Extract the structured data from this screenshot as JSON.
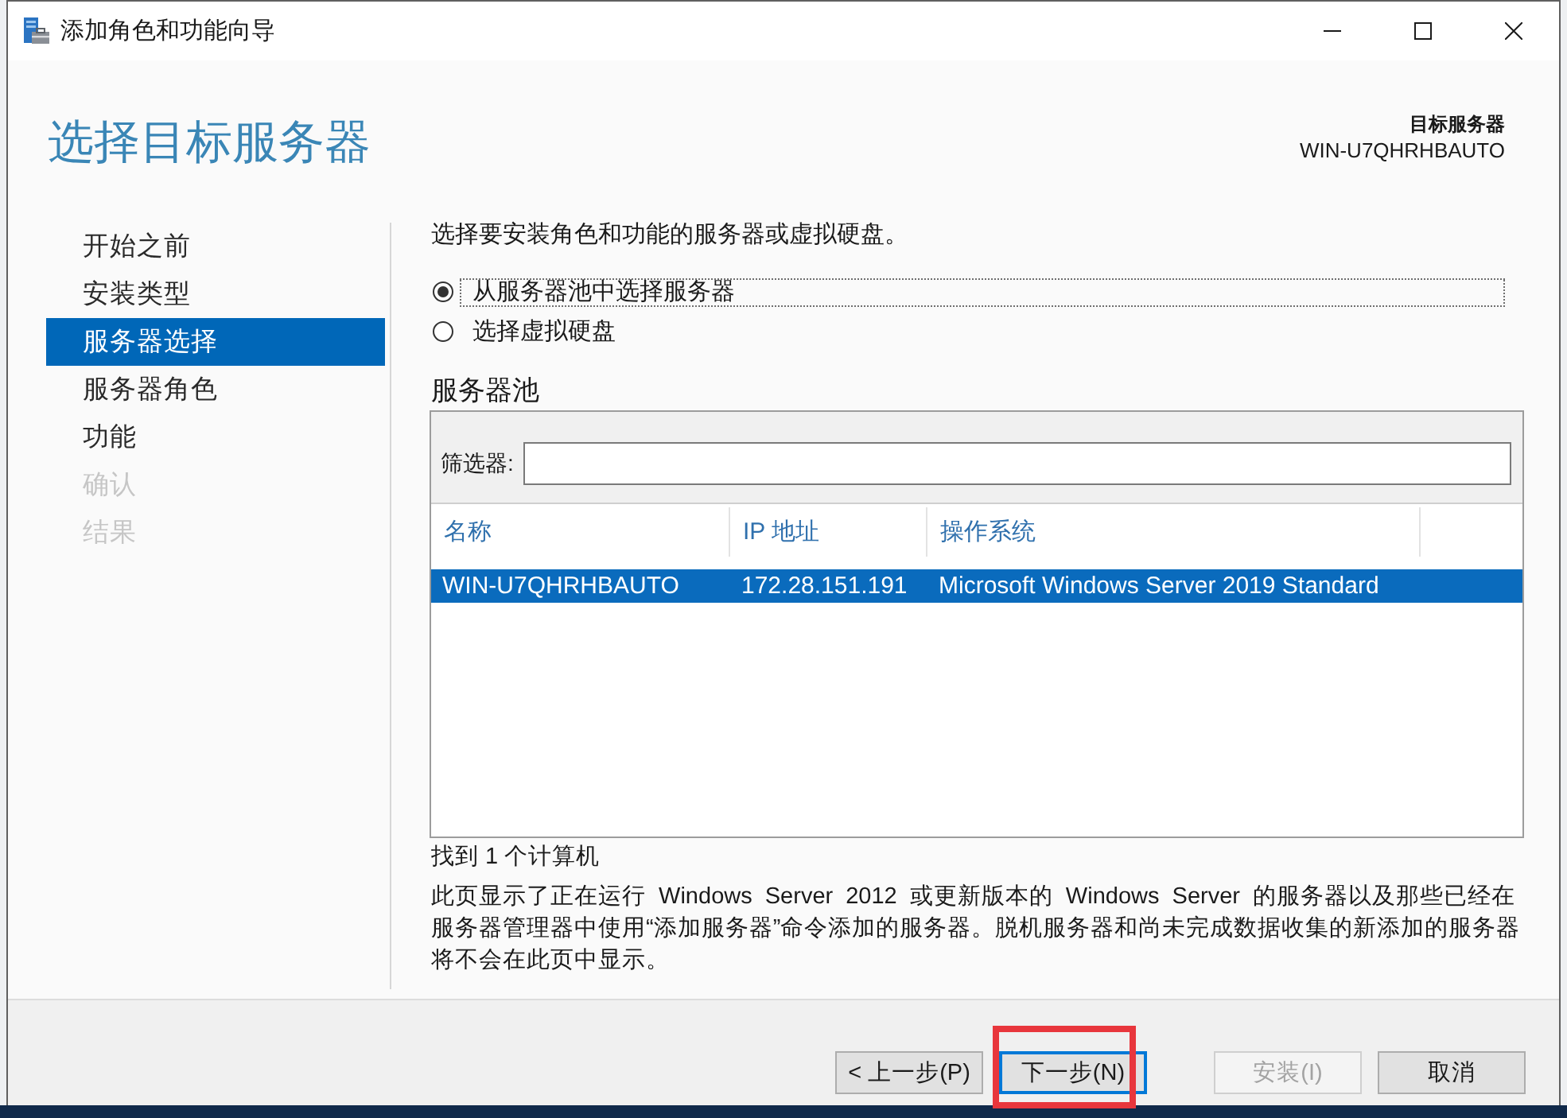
{
  "window": {
    "title": "添加角色和功能向导"
  },
  "header": {
    "title": "选择目标服务器",
    "target_label": "目标服务器",
    "target_server": "WIN-U7QHRHBAUTO"
  },
  "sidebar": {
    "items": [
      {
        "label": "开始之前",
        "selected": false,
        "disabled": false
      },
      {
        "label": "安装类型",
        "selected": false,
        "disabled": false
      },
      {
        "label": "服务器选择",
        "selected": true,
        "disabled": false
      },
      {
        "label": "服务器角色",
        "selected": false,
        "disabled": false
      },
      {
        "label": "功能",
        "selected": false,
        "disabled": false
      },
      {
        "label": "确认",
        "selected": false,
        "disabled": true
      },
      {
        "label": "结果",
        "selected": false,
        "disabled": true
      }
    ]
  },
  "content": {
    "intro": "选择要安装角色和功能的服务器或虚拟硬盘。",
    "options": [
      {
        "label": "从服务器池中选择服务器",
        "selected": true,
        "focused": true
      },
      {
        "label": "选择虚拟硬盘",
        "selected": false,
        "focused": false
      }
    ],
    "pool": {
      "title": "服务器池",
      "filter_label": "筛选器:",
      "table": {
        "columns": [
          "名称",
          "IP 地址",
          "操作系统"
        ],
        "rows": [
          {
            "cells": [
              "WIN-U7QHRHBAUTO",
              "172.28.151.191",
              "Microsoft Windows Server 2019 Standard"
            ],
            "selected": true
          }
        ]
      }
    },
    "count": "找到 1 个计算机",
    "note": "此页显示了正在运行 Windows Server 2012 或更新版本的 Windows Server 的服务器以及那些已经在服务器管理器中使用“添加服务器”命令添加的服务器。脱机服务器和尚未完成数据收集的新添加的服务器将不会在此页中显示。"
  },
  "footer": {
    "navigation_buttons": [
      {
        "label": "< 上一步(P)",
        "disabled": false,
        "default": false,
        "highlighted": false
      },
      {
        "label": "下一步(N)",
        "disabled": false,
        "default": true,
        "highlighted": true
      }
    ],
    "action_buttons": [
      {
        "label": "安装(I)",
        "disabled": true,
        "default": false,
        "highlighted": false
      },
      {
        "label": "取消",
        "disabled": false,
        "default": false,
        "highlighted": false
      }
    ]
  }
}
